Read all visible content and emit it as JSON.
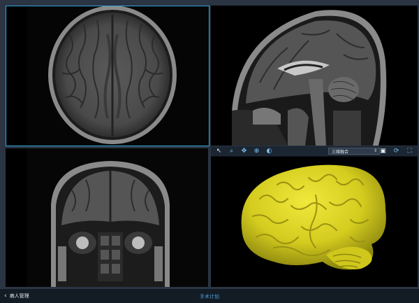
{
  "toolbar_3d": {
    "tools": [
      {
        "name": "pointer-icon",
        "glyph": "↖"
      },
      {
        "name": "zoom-icon",
        "glyph": "⌕"
      },
      {
        "name": "pan-icon",
        "glyph": "✥"
      },
      {
        "name": "rotate-icon",
        "glyph": "⊕"
      },
      {
        "name": "contrast-icon",
        "glyph": "◐"
      }
    ],
    "mode_select": "三维融合",
    "right_tools": [
      {
        "name": "screenshot-icon",
        "glyph": "▣"
      },
      {
        "name": "reset-icon",
        "glyph": "⟳"
      },
      {
        "name": "fullscreen-icon",
        "glyph": "⛶"
      }
    ]
  },
  "status": {
    "back_label": "病人管理",
    "title": "手术计划"
  },
  "colors": {
    "accent": "#33a6d6",
    "brain_3d": "#d4cc1e"
  }
}
